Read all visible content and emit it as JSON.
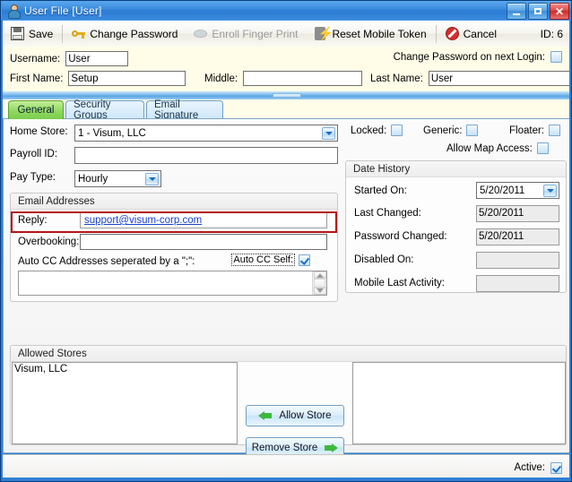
{
  "window": {
    "title": "User File [User]",
    "icon": "user-icon",
    "buttons": {
      "minimize": "minimize-icon",
      "maximize": "maximize-icon",
      "close": "close-icon"
    },
    "accent_color": "#2f7fd6",
    "header_background": "#fffde8"
  },
  "toolbar": {
    "items": [
      {
        "label": "Save",
        "icon": "floppy-disk-icon",
        "enabled": true
      },
      {
        "label": "Change Password",
        "icon": "key-icon",
        "enabled": true
      },
      {
        "label": "Enroll Finger Print",
        "icon": "fingerprint-icon",
        "enabled": false
      },
      {
        "label": "Reset Mobile Token",
        "icon": "mobile-token-icon",
        "enabled": true
      },
      {
        "label": "Cancel",
        "icon": "cancel-icon",
        "enabled": true
      }
    ],
    "id_text": "ID: 6"
  },
  "header": {
    "username_label": "Username:",
    "username_value": "User",
    "change_password_label": "Change Password on next Login:",
    "change_password_checked": false,
    "first_name_label": "First Name:",
    "first_name_value": "Setup",
    "middle_label": "Middle:",
    "middle_value": "",
    "last_name_label": "Last Name:",
    "last_name_value": "User"
  },
  "tabs": [
    {
      "label": "General",
      "active": true
    },
    {
      "label": "Security Groups",
      "active": false
    },
    {
      "label": "Email Signature",
      "active": false
    }
  ],
  "general": {
    "home_store_label": "Home Store:",
    "home_store_value": "1 - Visum, LLC",
    "payroll_id_label": "Payroll ID:",
    "payroll_id_value": "",
    "pay_type_label": "Pay Type:",
    "pay_type_value": "Hourly",
    "email_group_title": "Email Addresses",
    "reply_label": "Reply:",
    "reply_value": "support@visum-corp.com",
    "reply_highlight_color": "#b41717",
    "overbooking_label": "Overbooking:",
    "overbooking_value": "",
    "auto_cc_label": "Auto CC Addresses seperated by a \";\":",
    "auto_cc_self_label": "Auto CC Self:",
    "auto_cc_self_checked": true,
    "auto_cc_value": ""
  },
  "flags": {
    "locked_label": "Locked:",
    "locked_checked": false,
    "generic_label": "Generic:",
    "generic_checked": false,
    "floater_label": "Floater:",
    "floater_checked": false,
    "allow_map_access_label": "Allow Map Access:",
    "allow_map_access_checked": false
  },
  "date_history": {
    "title": "Date History",
    "rows": [
      {
        "label": "Started On:",
        "value": "5/20/2011",
        "readonly": false,
        "has_dropdown": true
      },
      {
        "label": "Last Changed:",
        "value": "5/20/2011",
        "readonly": true,
        "has_dropdown": false
      },
      {
        "label": "Password Changed:",
        "value": "5/20/2011",
        "readonly": true,
        "has_dropdown": false
      },
      {
        "label": "Disabled On:",
        "value": "",
        "readonly": true,
        "has_dropdown": false
      },
      {
        "label": "Mobile Last Activity:",
        "value": "",
        "readonly": true,
        "has_dropdown": false
      }
    ]
  },
  "allowed_stores": {
    "title": "Allowed Stores",
    "left_list": [
      "Visum, LLC"
    ],
    "right_list": [],
    "allow_button": "Allow Store",
    "remove_button": "Remove Store"
  },
  "statusbar": {
    "active_label": "Active:",
    "active_checked": true
  }
}
